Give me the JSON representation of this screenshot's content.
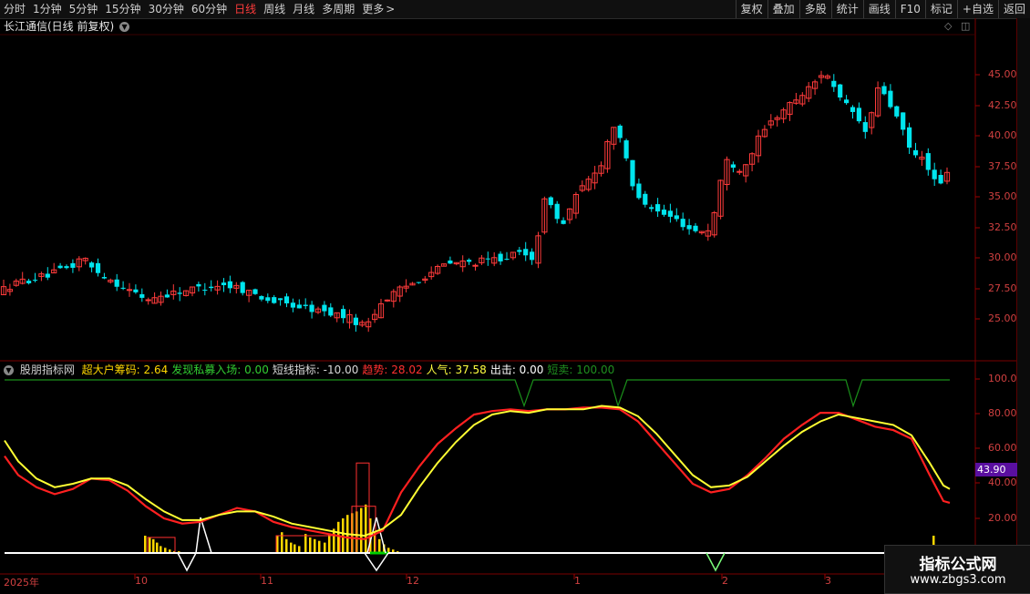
{
  "toolbar": {
    "periods": [
      "分时",
      "1分钟",
      "5分钟",
      "15分钟",
      "30分钟",
      "60分钟",
      "日线",
      "周线",
      "月线",
      "多周期",
      "更多"
    ],
    "active_period": "日线",
    "more_glyph": ">",
    "right": [
      "复权",
      "叠加",
      "多股",
      "统计",
      "画线",
      "F10",
      "标记",
      "+自选",
      "返回"
    ]
  },
  "stock": {
    "title": "长江通信(日线 前复权)"
  },
  "price_axis": {
    "labels": [
      "45.00",
      "42.50",
      "40.00",
      "37.50",
      "35.00",
      "32.50",
      "30.00",
      "27.50",
      "25.00"
    ]
  },
  "indicator": {
    "name": "股朋指标网",
    "items": [
      {
        "label": "超大户筹码: ",
        "value": "2.64",
        "color": "#ffd700"
      },
      {
        "label": "发现私募入场: ",
        "value": "0.00",
        "color": "#32cd32"
      },
      {
        "label": "短线指标: ",
        "value": "-10.00",
        "color": "#d8d8d8"
      },
      {
        "label": "趋势: ",
        "value": "28.02",
        "color": "#ff3030"
      },
      {
        "label": "人气: ",
        "value": "37.58",
        "color": "#ffff40"
      },
      {
        "label": "出击: ",
        "value": "0.00",
        "color": "#ffffff"
      },
      {
        "label": "短卖: ",
        "value": "100.00",
        "color": "#1f8f1f"
      }
    ],
    "axis": [
      "100.0",
      "80.00",
      "60.00",
      "40.00",
      "20.00"
    ],
    "current_badge": "43.90"
  },
  "dates": [
    "2025年",
    "10",
    "11",
    "12",
    "1",
    "2",
    "3"
  ],
  "logo": {
    "top": "指标公式网",
    "bottom": "www.zbgs3.com"
  },
  "colors": {
    "up": "#ff3b3b",
    "down": "#00e5ee",
    "trend": "#ff2020",
    "popularity": "#ffff33",
    "sell": "#1a8f1a"
  }
}
